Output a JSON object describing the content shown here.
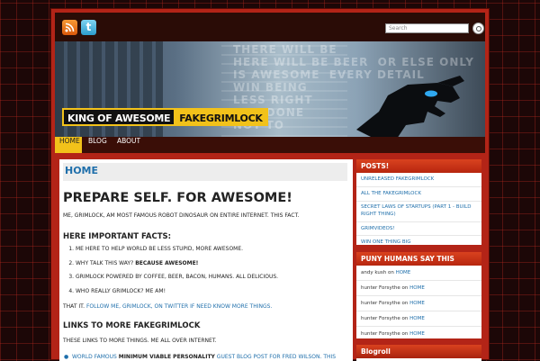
{
  "header": {
    "search_placeholder": "Search",
    "banner_title_a": "KING OF AWESOME",
    "banner_title_b": "FAKEGRIMLOCK",
    "banner_background_text": "THERE WILL BE\nHERE WILL BE BEER  OR ELSE ONLY\nIS AWESOME  EVERY DETAIL\nWIN BEING\nLESS RIGHT\nNOT DONE\nNOT TO"
  },
  "nav": {
    "items": [
      {
        "label": "HOME",
        "active": true
      },
      {
        "label": "BLOG",
        "active": false
      },
      {
        "label": "ABOUT",
        "active": false
      }
    ]
  },
  "main": {
    "page_title": "HOME",
    "post_title": "PREPARE SELF. FOR AWESOME!",
    "intro": "ME, GRIMLOCK, AM MOST FAMOUS ROBOT DINOSAUR ON ENTIRE INTERNET. THIS FACT.",
    "facts_heading": "HERE IMPORTANT FACTS:",
    "facts": [
      "ME HERE TO HELP WORLD BE LESS STUPID, MORE AWESOME.",
      "WHY TALK THIS WAY?",
      "GRIMLOCK POWERED BY COFFEE, BEER, BACON, HUMANS. ALL DELICIOUS.",
      "WHO REALLY GRIMLOCK? ME AM!"
    ],
    "fact2_bold": "BECAUSE AWESOME!",
    "that_it": "THAT IT.",
    "that_it_link": "FOLLOW ME, GRIMLOCK, ON TWITTER IF NEED KNOW MORE THINGS.",
    "links_heading": "LINKS TO MORE FAKEGRIMLOCK",
    "links_intro": "THESE LINKS TO MORE THINGS. ME ALL OVER INTERNET.",
    "link1_a": "WORLD FAMOUS ",
    "link1_b": "MINIMUM VIABLE PERSONALITY",
    "link1_c": " GUEST BLOG POST FOR FRED WILSON. THIS START OF IT ALL!"
  },
  "sidebar": {
    "posts_heading": "POSTS!",
    "posts": [
      "UNRELEASED FAKEGRIMLOCK",
      "ALL THE FAKEGRIMLOCK",
      "SECRET LAWS OF STARTUPS (PART 1 - BUILD RIGHT THING)",
      "GRIMVIDEOS!",
      "WIN ONE THING BIG"
    ],
    "comments_heading": "PUNY HUMANS SAY THIS",
    "comments": [
      {
        "author": "andy kush",
        "on": "on",
        "target": "HOME"
      },
      {
        "author": "hunter Forsythe",
        "on": "on",
        "target": "HOME"
      },
      {
        "author": "hunter Forsythe",
        "on": "on",
        "target": "HOME"
      },
      {
        "author": "hunter Forsythe",
        "on": "on",
        "target": "HOME"
      },
      {
        "author": "hunter Forsythe",
        "on": "on",
        "target": "HOME"
      }
    ],
    "blogroll_heading": "Blogroll"
  },
  "colors": {
    "accent": "#b32417",
    "nav_active": "#f2c21a",
    "link": "#1f6fab"
  },
  "icons": [
    "rss-icon",
    "twitter-icon",
    "search-icon"
  ]
}
